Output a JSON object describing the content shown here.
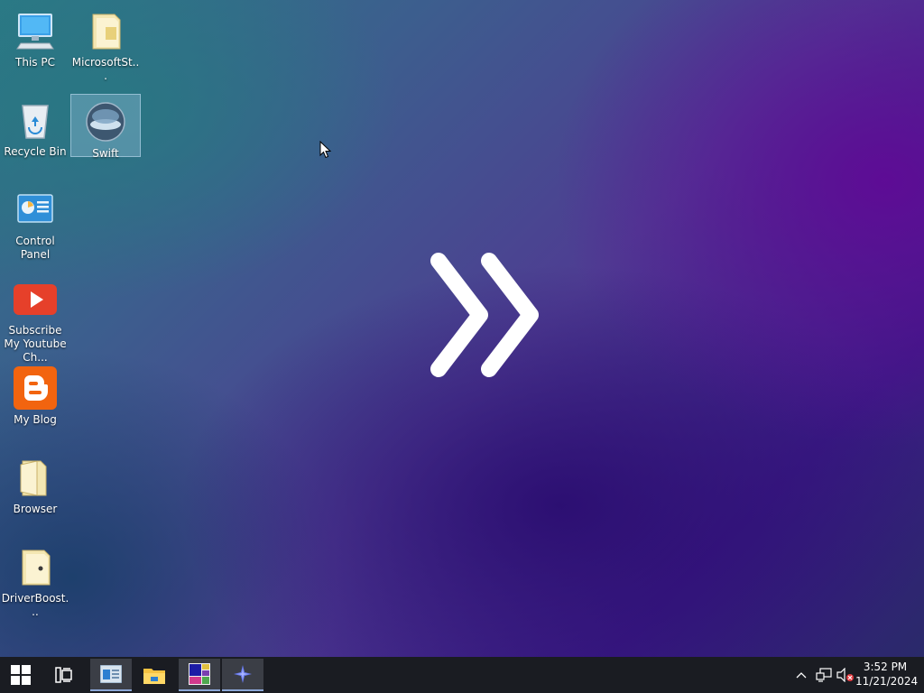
{
  "desktop": {
    "icons": [
      {
        "label": "This PC",
        "icon": "computer-icon"
      },
      {
        "label": "MicrosoftSt...",
        "icon": "folder-icon"
      },
      {
        "label": "Recycle Bin",
        "icon": "recycle-bin-icon"
      },
      {
        "label": "Swift",
        "icon": "swift-app-icon"
      },
      {
        "label": "Control Panel",
        "icon": "control-panel-icon"
      },
      {
        "label": "Subscribe My Youtube Ch...",
        "icon": "youtube-icon"
      },
      {
        "label": "My Blog",
        "icon": "blogger-icon"
      },
      {
        "label": "Browser",
        "icon": "folder-icon"
      },
      {
        "label": "DriverBoost...",
        "icon": "folder-icon"
      }
    ]
  },
  "taskbar": {
    "start": "windows-logo-icon",
    "task_view": "task-view-icon",
    "pinned": [
      {
        "name": "app-window-icon"
      },
      {
        "name": "file-explorer-icon"
      },
      {
        "name": "color-app-icon"
      },
      {
        "name": "swift-app-icon"
      }
    ],
    "clock": {
      "time": "3:52 PM",
      "date": "11/21/2024"
    }
  },
  "colors": {
    "taskbar": "#1a1c22",
    "accent": "#8aa6d6"
  }
}
